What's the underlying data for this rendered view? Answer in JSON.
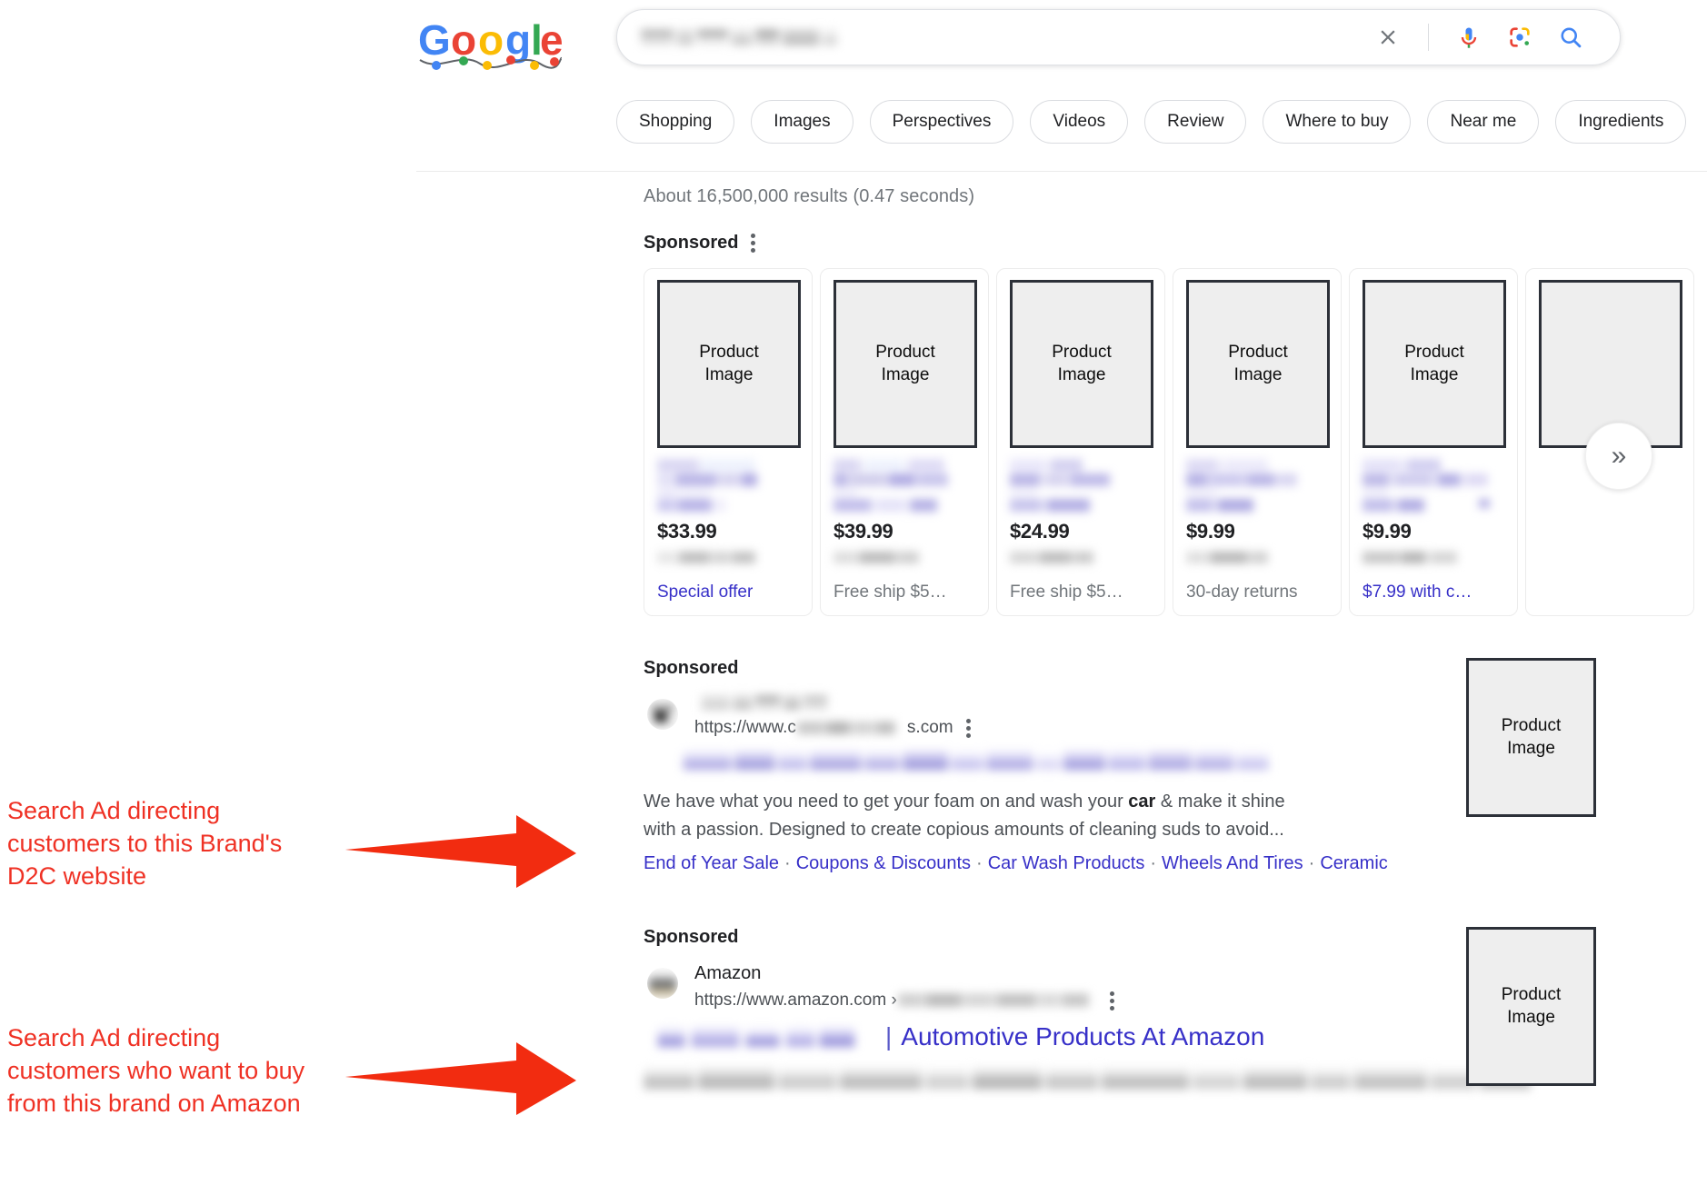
{
  "header": {
    "logo_alt": "Google holiday doodle",
    "search": {
      "query_redacted": true,
      "placeholder": "Search"
    },
    "icons": [
      "close-icon",
      "microphone-icon",
      "google-lens-icon",
      "search-icon"
    ]
  },
  "filters": {
    "chips": [
      "Shopping",
      "Images",
      "Perspectives",
      "Videos",
      "Review",
      "Where to buy",
      "Near me",
      "Ingredients"
    ]
  },
  "results": {
    "stats": "About 16,500,000 results (0.47 seconds)",
    "sponsored_label": "Sponsored"
  },
  "shopping_carousel": {
    "next_label": "»",
    "image_placeholder": "Product\nImage",
    "cards": [
      {
        "price": "$33.99",
        "offer": "Special offer",
        "offer_is_link": true
      },
      {
        "price": "$39.99",
        "offer": "Free ship $5…",
        "offer_is_link": false
      },
      {
        "price": "$24.99",
        "offer": "Free ship $5…",
        "offer_is_link": false
      },
      {
        "price": "$9.99",
        "offer": "30-day returns",
        "offer_is_link": false
      },
      {
        "price": "$9.99",
        "offer": "$7.99 with c…",
        "offer_is_link": true
      },
      {
        "price": "",
        "offer": "",
        "offer_is_link": false
      }
    ]
  },
  "ads": [
    {
      "sponsored": "Sponsored",
      "site_name_redacted": true,
      "site_name": "",
      "url_prefix": "https://www.c",
      "url_suffix": "s.com",
      "title_redacted": true,
      "title": "",
      "description_part1": "We have what you need to get your foam on and wash your ",
      "description_bold": "car",
      "description_part2": " & make it shine with a passion. Designed to create copious amounts of cleaning suds to avoid...",
      "sitelinks": [
        "End of Year Sale",
        "Coupons & Discounts",
        "Car Wash Products",
        "Wheels And Tires",
        "Ceramic"
      ],
      "thumb_label": "Product\nImage"
    },
    {
      "sponsored": "Sponsored",
      "site_name_redacted": false,
      "site_name": "Amazon",
      "url_prefix": "https://www.amazon.com › ",
      "url_suffix": "",
      "title_redacted": true,
      "title": "Automotive Products At Amazon",
      "title_separator": "|",
      "description_part1": "",
      "description_bold": "",
      "description_part2": "",
      "sitelinks": [],
      "thumb_label": "Product\nImage"
    }
  ],
  "annotations": [
    {
      "text": "Search Ad directing customers to this Brand's D2C website",
      "color": "#ef3124"
    },
    {
      "text": "Search Ad directing customers who want to buy from this brand on Amazon",
      "color": "#ef3124"
    }
  ],
  "colors": {
    "accent_link": "#3730c8",
    "annotation_red": "#ef3124",
    "placeholder_fill": "#eeeeee",
    "placeholder_border": "#2c3038"
  }
}
